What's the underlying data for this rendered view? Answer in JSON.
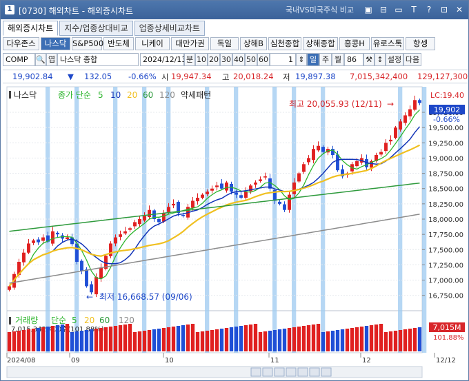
{
  "window": {
    "app_icon": "1",
    "title": "[0730] 해외차트 - 해외증시차트",
    "compare_label": "국내VS미국주식 비교",
    "buttons": [
      "restore-icon",
      "window-icon",
      "minimize-icon",
      "help-icon",
      "pin-icon",
      "close-icon"
    ]
  },
  "tabs": [
    "해외증시차트",
    "지수/업종상대비교",
    "업종상세비교차트"
  ],
  "index_buttons": [
    "다우존스",
    "나스닥",
    "S&P500",
    "반도체",
    "니케이",
    "대만가권",
    "독일",
    "상해B",
    "심천종합",
    "상해종합",
    "홍콩H",
    "유로스톡",
    "항셍"
  ],
  "selected_index": "나스닥",
  "toolbar": {
    "code": "COMP",
    "kind_btn": "엽",
    "name": "나스닥 종합",
    "date": "2024/12/13",
    "period_btn": "분",
    "intervals": [
      "10",
      "20",
      "30",
      "40",
      "50",
      "60"
    ],
    "count": "1",
    "day": "일",
    "week": "주",
    "month": "월",
    "bars": "86",
    "settings": "설정",
    "next": "다음"
  },
  "quote": {
    "price": "19,902.84",
    "arrow": "▼",
    "change": "132.05",
    "change_pct": "-0.66%",
    "open_label": "시",
    "open": "19,947.34",
    "high_label": "고",
    "high": "20,018.24",
    "low_label": "저",
    "low": "19,897.38",
    "volume": "7,015,342,400",
    "amount": "129,127,300"
  },
  "legend": {
    "name": "나스닥",
    "ma_label": "종가 단순",
    "ma": [
      "5",
      "10",
      "20",
      "60",
      "120"
    ],
    "pattern": "약세패턴"
  },
  "annotations": {
    "high": "최고 20,055.93 (12/11)",
    "low": "최저 16,668.57 (09/06)",
    "lc": "LC:19.40",
    "last_price": "19,902",
    "last_pct": "-0.66%"
  },
  "volume_legend": {
    "label": "거래량",
    "ma_label": "단순",
    "ma": [
      "5",
      "20",
      "60",
      "120"
    ],
    "value": "7,015,342,400주(101.88%)",
    "tag": "7,015M",
    "tag_pct": "101.88%"
  },
  "chart_data": {
    "type": "candlestick",
    "x_labels": [
      "2024/08",
      "09",
      "10",
      "11",
      "12",
      "12/12"
    ],
    "y_ticks": [
      "19,750.00",
      "19,500.00",
      "19,250.00",
      "19,000.00",
      "18,750.00",
      "18,500.00",
      "18,250.00",
      "18,000.00",
      "17,750.00",
      "17,500.00",
      "17,250.00",
      "17,000.00",
      "16,750.00"
    ],
    "ylim": [
      16600,
      20100
    ],
    "close": [
      16900,
      17100,
      17300,
      17450,
      17600,
      17650,
      17620,
      17700,
      17630,
      17800,
      17750,
      17680,
      17700,
      17590,
      17300,
      17150,
      16900,
      16800,
      17050,
      17200,
      17400,
      17600,
      17700,
      17750,
      17800,
      17850,
      17950,
      18000,
      18050,
      18150,
      18000,
      17950,
      18100,
      18200,
      18250,
      18100,
      18050,
      18200,
      18300,
      18350,
      18400,
      18450,
      18500,
      18550,
      18500,
      18600,
      18450,
      18400,
      18350,
      18450,
      18550,
      18600,
      18650,
      18700,
      18500,
      18300,
      18250,
      18150,
      18400,
      18600,
      18750,
      18900,
      19000,
      19150,
      19200,
      19100,
      19150,
      19050,
      18800,
      18700,
      18750,
      18900,
      18950,
      19000,
      18850,
      18950,
      19050,
      19100,
      19250,
      19300,
      19500,
      19600,
      19700,
      19800,
      19950,
      19902
    ]
  },
  "colors": {
    "up": "#e02020",
    "down": "#1f4fd6",
    "ma5": "#2db52d",
    "ma10": "#1234b8",
    "ma20": "#f0c020",
    "ma60": "#2e9a3c",
    "ma120": "#8c8c8c",
    "shade": "#9ec9f0"
  }
}
